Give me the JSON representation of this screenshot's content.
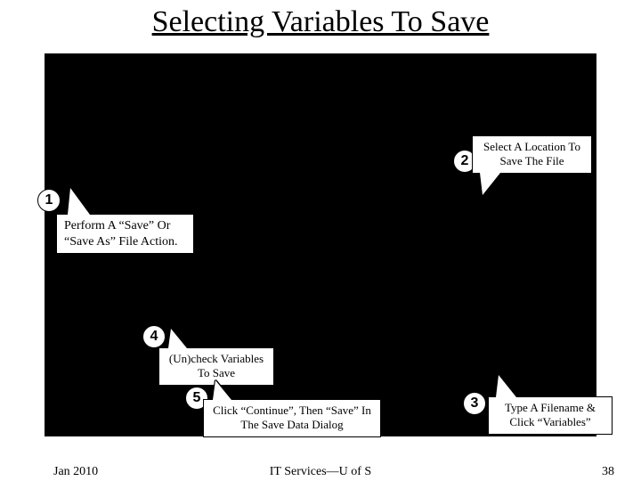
{
  "title": "Selecting Variables To Save",
  "callouts": {
    "c1": {
      "num": "1",
      "text": "Perform A “Save” Or “Save As” File Action."
    },
    "c2": {
      "num": "2",
      "text": "Select A Location To Save The File"
    },
    "c3": {
      "num": "3",
      "text": "Type A Filename & Click “Variables”"
    },
    "c4": {
      "num": "4",
      "text": "(Un)check Variables To Save"
    },
    "c5": {
      "num": "5",
      "text": "Click “Continue”, Then “Save” In The Save Data Dialog"
    }
  },
  "footer": {
    "left": "Jan 2010",
    "center": "IT Services—U of S",
    "right": "38"
  }
}
